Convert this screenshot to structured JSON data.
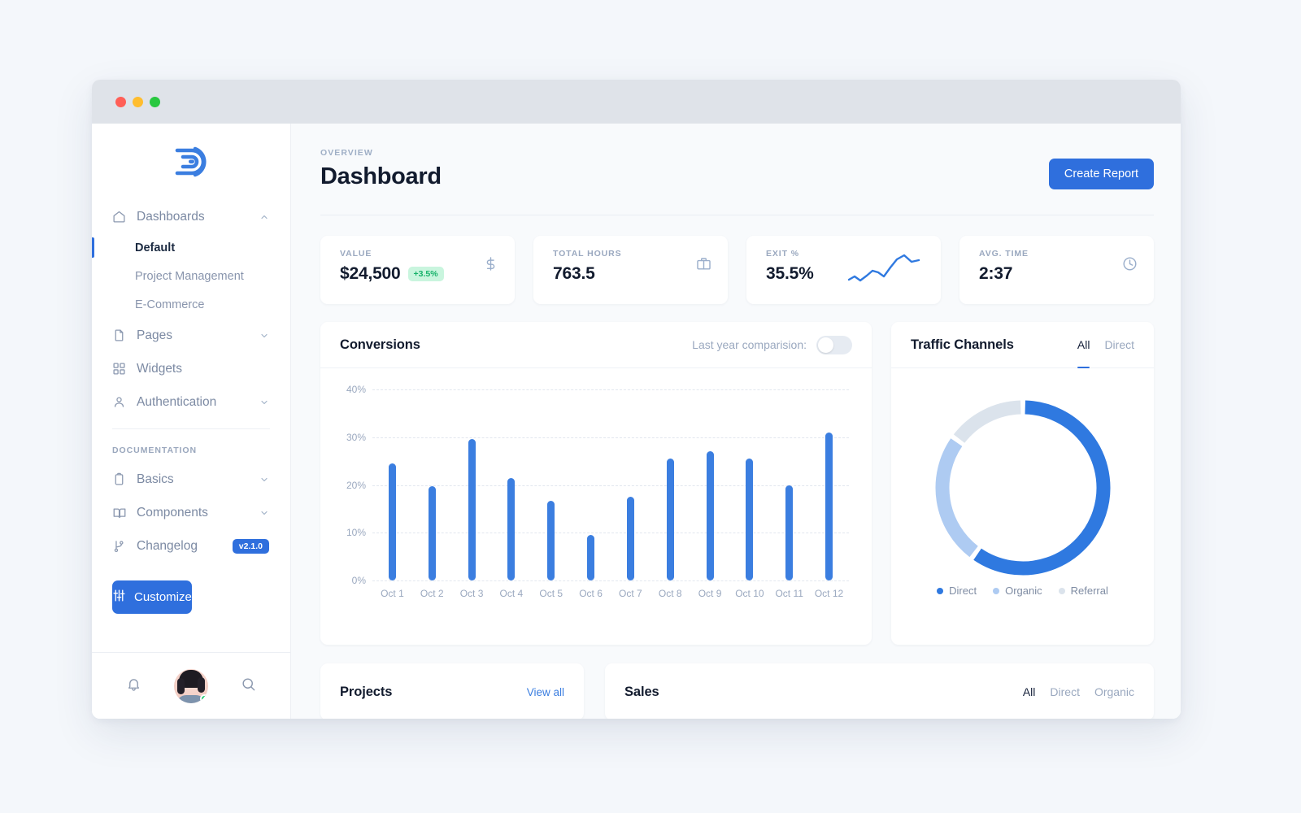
{
  "window": {
    "traffic_lights": [
      "close",
      "minimize",
      "maximize"
    ]
  },
  "sidebar": {
    "logo_name": "brand-logo",
    "nav": [
      {
        "label": "Dashboards",
        "icon": "home-icon",
        "chevron": "chevron-up",
        "expanded": true
      },
      {
        "label": "Pages",
        "icon": "file-icon",
        "chevron": "chevron-down",
        "expanded": false
      },
      {
        "label": "Widgets",
        "icon": "grid-icon",
        "chevron": "",
        "expanded": false
      },
      {
        "label": "Authentication",
        "icon": "user-icon",
        "chevron": "chevron-down",
        "expanded": false
      }
    ],
    "dashboard_children": [
      {
        "label": "Default",
        "active": true
      },
      {
        "label": "Project Management",
        "active": false
      },
      {
        "label": "E-Commerce",
        "active": false
      }
    ],
    "documentation_title": "DOCUMENTATION",
    "doc_nav": [
      {
        "label": "Basics",
        "icon": "clipboard-icon",
        "chevron": "chevron-down"
      },
      {
        "label": "Components",
        "icon": "book-icon",
        "chevron": "chevron-down"
      },
      {
        "label": "Changelog",
        "icon": "git-branch-icon",
        "badge": "v2.1.0"
      }
    ],
    "changelog_badge": "v2.1.0",
    "customize_label": "Customize",
    "footer_icons": [
      "bell-icon",
      "avatar",
      "search-icon"
    ]
  },
  "header": {
    "eyebrow": "OVERVIEW",
    "title": "Dashboard",
    "create_button": "Create Report"
  },
  "stats": [
    {
      "label": "VALUE",
      "value": "$24,500",
      "delta": "+3.5%",
      "icon": "dollar-icon"
    },
    {
      "label": "TOTAL HOURS",
      "value": "763.5",
      "delta": "",
      "icon": "briefcase-icon"
    },
    {
      "label": "EXIT %",
      "value": "35.5%",
      "delta": "",
      "icon": "sparkline-icon"
    },
    {
      "label": "AVG. TIME",
      "value": "2:37",
      "delta": "",
      "icon": "clock-icon"
    }
  ],
  "conversions": {
    "title": "Conversions",
    "toggle_label": "Last year comparision:",
    "toggle_on": false
  },
  "traffic": {
    "title": "Traffic Channels",
    "tabs": [
      {
        "label": "All",
        "active": true
      },
      {
        "label": "Direct",
        "active": false
      }
    ]
  },
  "bottom": {
    "projects_title": "Projects",
    "projects_view_all": "View all",
    "sales_title": "Sales",
    "sales_tabs": [
      {
        "label": "All",
        "active": true
      },
      {
        "label": "Direct",
        "active": false
      },
      {
        "label": "Organic",
        "active": false
      }
    ]
  },
  "colors": {
    "accent": "#2f6fdd",
    "bar": "#3b7ee0",
    "donut_direct": "#2f79e0",
    "donut_organic": "#aecbf2",
    "donut_referral": "#dbe3ec",
    "positive": "#17b26a",
    "positive_bg": "#c9f5de"
  },
  "chart_data": [
    {
      "type": "bar",
      "title": "Conversions",
      "categories": [
        "Oct 1",
        "Oct 2",
        "Oct 3",
        "Oct 4",
        "Oct 5",
        "Oct 6",
        "Oct 7",
        "Oct 8",
        "Oct 9",
        "Oct 10",
        "Oct 11",
        "Oct 12"
      ],
      "values": [
        24.5,
        19.7,
        29.7,
        21.5,
        16.7,
        9.5,
        17.5,
        25.5,
        27.0,
        25.5,
        20.0,
        31.0
      ],
      "xlabel": "",
      "ylabel": "",
      "ylim": [
        0,
        40
      ],
      "yticks": [
        0,
        10,
        20,
        30,
        40
      ],
      "ytick_labels": [
        "0%",
        "10%",
        "20%",
        "30%",
        "40%"
      ],
      "grid": true,
      "legend": false
    },
    {
      "type": "pie",
      "title": "Traffic Channels",
      "variant": "donut",
      "labels": [
        "Direct",
        "Organic",
        "Referral"
      ],
      "values": [
        60,
        25,
        15
      ],
      "colors": [
        "#2f79e0",
        "#aecbf2",
        "#dbe3ec"
      ],
      "legend_position": "bottom"
    },
    {
      "type": "line",
      "title": "Exit % sparkline",
      "values": [
        8,
        5,
        12,
        8,
        16,
        14,
        10,
        30,
        44,
        62,
        52,
        56
      ],
      "legend": false,
      "grid": false
    }
  ]
}
